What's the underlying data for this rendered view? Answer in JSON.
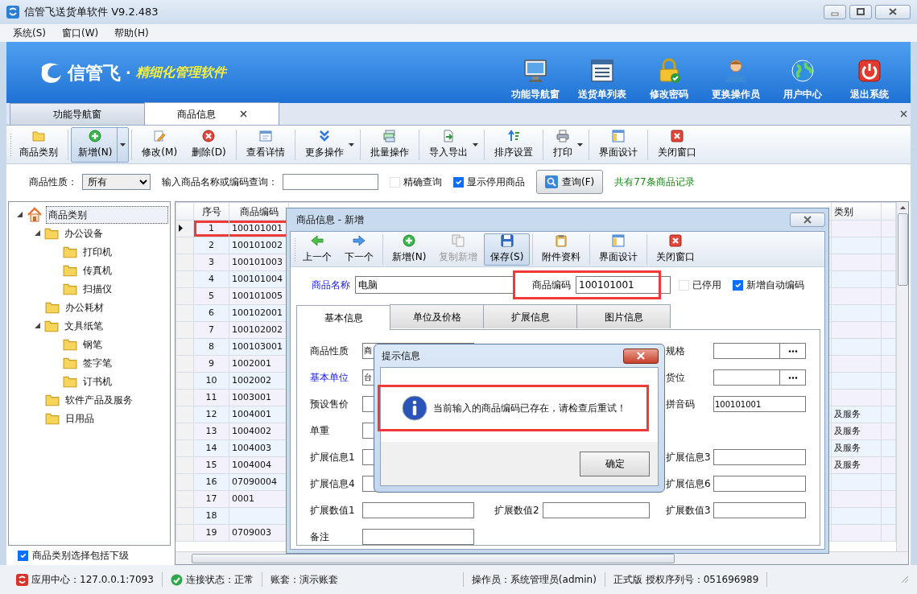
{
  "window": {
    "title": "信管飞送货单软件 V9.2.483"
  },
  "menu": [
    {
      "label": "系统(S)"
    },
    {
      "label": "窗口(W)"
    },
    {
      "label": "帮助(H)"
    }
  ],
  "banner": {
    "logo_text": "信管飞",
    "separator": "·",
    "tagline": "精细化管理软件",
    "nav": [
      {
        "label": "功能导航窗"
      },
      {
        "label": "送货单列表"
      },
      {
        "label": "修改密码"
      },
      {
        "label": "更换操作员"
      },
      {
        "label": "用户中心"
      },
      {
        "label": "退出系统"
      }
    ]
  },
  "tabs": [
    {
      "label": "功能导航窗",
      "selected": false,
      "closable": false
    },
    {
      "label": "商品信息",
      "selected": true,
      "closable": true
    }
  ],
  "toolbar": [
    {
      "kind": "button",
      "label": "商品类别",
      "pressed": false,
      "dropdown": false
    },
    {
      "kind": "separator"
    },
    {
      "kind": "button",
      "label": "新增(N)",
      "pressed": true,
      "dropdown": true
    },
    {
      "kind": "separator"
    },
    {
      "kind": "button",
      "label": "修改(M)",
      "pressed": false,
      "dropdown": false
    },
    {
      "kind": "button",
      "label": "删除(D)",
      "pressed": false,
      "dropdown": false
    },
    {
      "kind": "separator"
    },
    {
      "kind": "button",
      "label": "查看详情",
      "pressed": false,
      "dropdown": false
    },
    {
      "kind": "separator"
    },
    {
      "kind": "button",
      "label": "更多操作",
      "pressed": false,
      "dropdown": true
    },
    {
      "kind": "separator"
    },
    {
      "kind": "button",
      "label": "批量操作",
      "pressed": false,
      "dropdown": false
    },
    {
      "kind": "separator"
    },
    {
      "kind": "button",
      "label": "导入导出",
      "pressed": false,
      "dropdown": true
    },
    {
      "kind": "separator"
    },
    {
      "kind": "button",
      "label": "排序设置",
      "pressed": false,
      "dropdown": false
    },
    {
      "kind": "separator"
    },
    {
      "kind": "button",
      "label": "打印",
      "pressed": false,
      "dropdown": true
    },
    {
      "kind": "separator"
    },
    {
      "kind": "button",
      "label": "界面设计",
      "pressed": false,
      "dropdown": false
    },
    {
      "kind": "separator"
    },
    {
      "kind": "button",
      "label": "关闭窗口",
      "pressed": false,
      "dropdown": false
    }
  ],
  "filter": {
    "nature_label": "商品性质：",
    "nature_value": "所有",
    "search_label": "输入商品名称或编码查询：",
    "exact": {
      "label": "精确查询",
      "checked": false
    },
    "show_disabled": {
      "label": "显示停用商品",
      "checked": true
    },
    "query_button": "查询(F)",
    "count": "共有77条商品记录"
  },
  "tree": {
    "nodes": [
      {
        "label": "商品类别",
        "selected": true,
        "expanded": true,
        "children": [
          {
            "label": "办公设备",
            "selected": false,
            "expanded": true,
            "children": [
              {
                "label": "打印机",
                "selected": false
              },
              {
                "label": "传真机",
                "selected": false
              },
              {
                "label": "扫描仪",
                "selected": false
              }
            ]
          },
          {
            "label": "办公耗材",
            "selected": false
          },
          {
            "label": "文具纸笔",
            "selected": false,
            "expanded": true,
            "children": [
              {
                "label": "钢笔",
                "selected": false
              },
              {
                "label": "签字笔",
                "selected": false
              },
              {
                "label": "订书机",
                "selected": false
              }
            ]
          },
          {
            "label": "软件产品及服务",
            "selected": false
          },
          {
            "label": "日用品",
            "selected": false
          }
        ]
      }
    ],
    "include_children": {
      "label": "商品类别选择包括下级",
      "checked": true
    }
  },
  "table": {
    "columns": [
      "序号",
      "商品编码",
      "类别"
    ],
    "rows": [
      {
        "no": "1",
        "code": "100101001",
        "current": true,
        "highlighted": true
      },
      {
        "no": "2",
        "code": "100101002",
        "current": false,
        "highlighted": false
      },
      {
        "no": "3",
        "code": "100101003",
        "current": false,
        "highlighted": false
      },
      {
        "no": "4",
        "code": "100101004",
        "current": false,
        "highlighted": false
      },
      {
        "no": "5",
        "code": "100101005",
        "current": false,
        "highlighted": false
      },
      {
        "no": "6",
        "code": "100102001",
        "current": false,
        "highlighted": false
      },
      {
        "no": "7",
        "code": "100102002",
        "current": false,
        "highlighted": false
      },
      {
        "no": "8",
        "code": "100103001",
        "current": false,
        "highlighted": false
      },
      {
        "no": "9",
        "code": "1002001",
        "current": false,
        "highlighted": false
      },
      {
        "no": "10",
        "code": "1002002",
        "current": false,
        "highlighted": false
      },
      {
        "no": "11",
        "code": "1003001",
        "current": false,
        "highlighted": false
      },
      {
        "no": "12",
        "code": "1004001",
        "category": "及服务",
        "current": false,
        "highlighted": false
      },
      {
        "no": "13",
        "code": "1004002",
        "category": "及服务",
        "current": false,
        "highlighted": false
      },
      {
        "no": "14",
        "code": "1004003",
        "category": "及服务",
        "current": false,
        "highlighted": false
      },
      {
        "no": "15",
        "code": "1004004",
        "category": "及服务",
        "current": false,
        "highlighted": false
      },
      {
        "no": "16",
        "code": "07090004",
        "current": false,
        "highlighted": false
      },
      {
        "no": "17",
        "code": "0001",
        "current": false,
        "highlighted": false
      },
      {
        "no": "18",
        "current": false,
        "highlighted": false
      },
      {
        "no": "19",
        "code": "0709003",
        "current": false,
        "highlighted": false
      }
    ]
  },
  "editor": {
    "title": "商品信息 - 新增",
    "toolbar": [
      {
        "kind": "button",
        "label": "上一个",
        "disabled": false,
        "pressed": false
      },
      {
        "kind": "button",
        "label": "下一个",
        "disabled": false,
        "pressed": false
      },
      {
        "kind": "separator"
      },
      {
        "kind": "button",
        "label": "新增(N)",
        "disabled": false,
        "pressed": false
      },
      {
        "kind": "button",
        "label": "复制新增",
        "disabled": true,
        "pressed": false
      },
      {
        "kind": "button",
        "label": "保存(S)",
        "disabled": false,
        "pressed": true
      },
      {
        "kind": "separator"
      },
      {
        "kind": "button",
        "label": "附件资料",
        "disabled": false,
        "pressed": false
      },
      {
        "kind": "separator"
      },
      {
        "kind": "button",
        "label": "界面设计",
        "disabled": false,
        "pressed": false
      },
      {
        "kind": "separator"
      },
      {
        "kind": "button",
        "label": "关闭窗口",
        "disabled": false,
        "pressed": false
      }
    ],
    "name": {
      "label": "商品名称",
      "value": "电脑",
      "required": true
    },
    "code": {
      "label": "商品编码",
      "value": "100101001",
      "required": false,
      "highlighted": true
    },
    "inactive": {
      "label": "已停用",
      "checked": false
    },
    "auto_code": {
      "label": "新增自动编码",
      "checked": true
    },
    "tabs": [
      {
        "label": "基本信息",
        "selected": true
      },
      {
        "label": "单位及价格",
        "selected": false
      },
      {
        "label": "扩展信息",
        "selected": false
      },
      {
        "label": "图片信息",
        "selected": false
      }
    ],
    "form_rows": [
      [
        {
          "label": "商品性质",
          "value": "商",
          "kind": "select",
          "required": false
        },
        null,
        {
          "label": "规格",
          "kind": "browse",
          "required": false
        }
      ],
      [
        {
          "label": "基本单位",
          "value": "台",
          "kind": "text",
          "required": true
        },
        null,
        {
          "label": "货位",
          "kind": "browse",
          "required": false
        }
      ],
      [
        {
          "label": "预设售价",
          "kind": "text",
          "required": false
        },
        null,
        {
          "label": "拼音码",
          "value": "100101001",
          "kind": "text",
          "required": false
        }
      ],
      [
        {
          "label": "单重",
          "kind": "text",
          "required": false
        },
        null,
        null
      ],
      [
        {
          "label": "扩展信息1",
          "kind": "text",
          "required": false
        },
        null,
        {
          "label": "扩展信息3",
          "kind": "text",
          "required": false
        }
      ],
      [
        {
          "label": "扩展信息4",
          "kind": "text",
          "required": false
        },
        null,
        {
          "label": "扩展信息6",
          "kind": "text",
          "required": false
        }
      ],
      [
        {
          "label": "扩展数值1",
          "kind": "text",
          "required": false
        },
        {
          "label": "扩展数值2",
          "kind": "text",
          "required": false
        },
        {
          "label": "扩展数值3",
          "kind": "text",
          "required": false
        }
      ],
      [
        {
          "label": "备注",
          "kind": "text",
          "required": false
        },
        null,
        null
      ]
    ]
  },
  "prompt": {
    "title": "提示信息",
    "message": "当前输入的商品编码已存在，请检查后重试！",
    "button": "确定",
    "highlighted": true
  },
  "status_bar": [
    {
      "text": "应用中心：127.0.0.1:7093"
    },
    {
      "text": "连接状态：正常"
    },
    {
      "text": "账套：演示账套"
    },
    {
      "text": "操作员：系统管理员(admin)"
    },
    {
      "text": "正式版 授权序列号：051696989"
    }
  ]
}
